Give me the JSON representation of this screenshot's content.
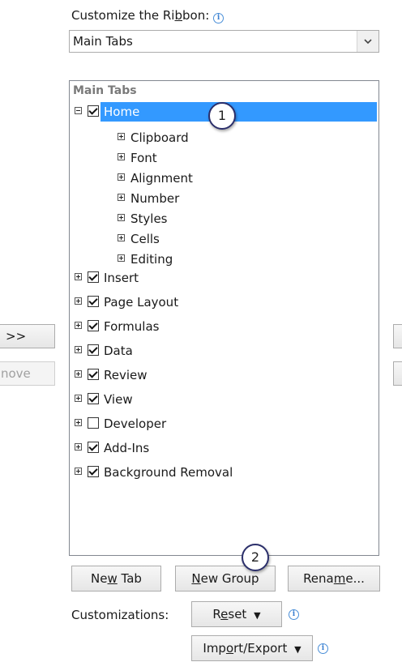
{
  "header": {
    "label_pre": "Customize the Ri",
    "label_u": "b",
    "label_post": "bon:"
  },
  "dropdown": {
    "value": "Main Tabs"
  },
  "tree": {
    "header": "Main Tabs",
    "home": {
      "label": "Home",
      "checked": true,
      "expanded": true
    },
    "groups": [
      "Clipboard",
      "Font",
      "Alignment",
      "Number",
      "Styles",
      "Cells",
      "Editing"
    ],
    "tabs": [
      {
        "label": "Insert",
        "checked": true
      },
      {
        "label": "Page Layout",
        "checked": true
      },
      {
        "label": "Formulas",
        "checked": true
      },
      {
        "label": "Data",
        "checked": true
      },
      {
        "label": "Review",
        "checked": true
      },
      {
        "label": "View",
        "checked": true
      },
      {
        "label": "Developer",
        "checked": false
      },
      {
        "label": "Add-Ins",
        "checked": true
      },
      {
        "label": "Background Removal",
        "checked": true
      }
    ]
  },
  "left_buttons": {
    "add": ">>",
    "remove": "nove"
  },
  "buttons": {
    "new_tab": {
      "pre": "Ne",
      "u": "w",
      "post": " Tab"
    },
    "new_group": {
      "pre": "",
      "u": "N",
      "post": "ew Group"
    },
    "rename": {
      "pre": "Rena",
      "u": "m",
      "post": "e..."
    }
  },
  "customizations": {
    "label": "Customizations:",
    "reset": {
      "pre": "R",
      "u": "e",
      "post": "set"
    },
    "import_export": {
      "pre": "Imp",
      "u": "o",
      "post": "rt/Export"
    }
  },
  "callouts": {
    "one": "1",
    "two": "2"
  },
  "icons": {
    "info": "i",
    "dropdown_arrow": "chevron-down-icon",
    "split_arrow": "▼"
  },
  "colors": {
    "selection": "#3399ff",
    "accent": "#3b7fd0"
  }
}
